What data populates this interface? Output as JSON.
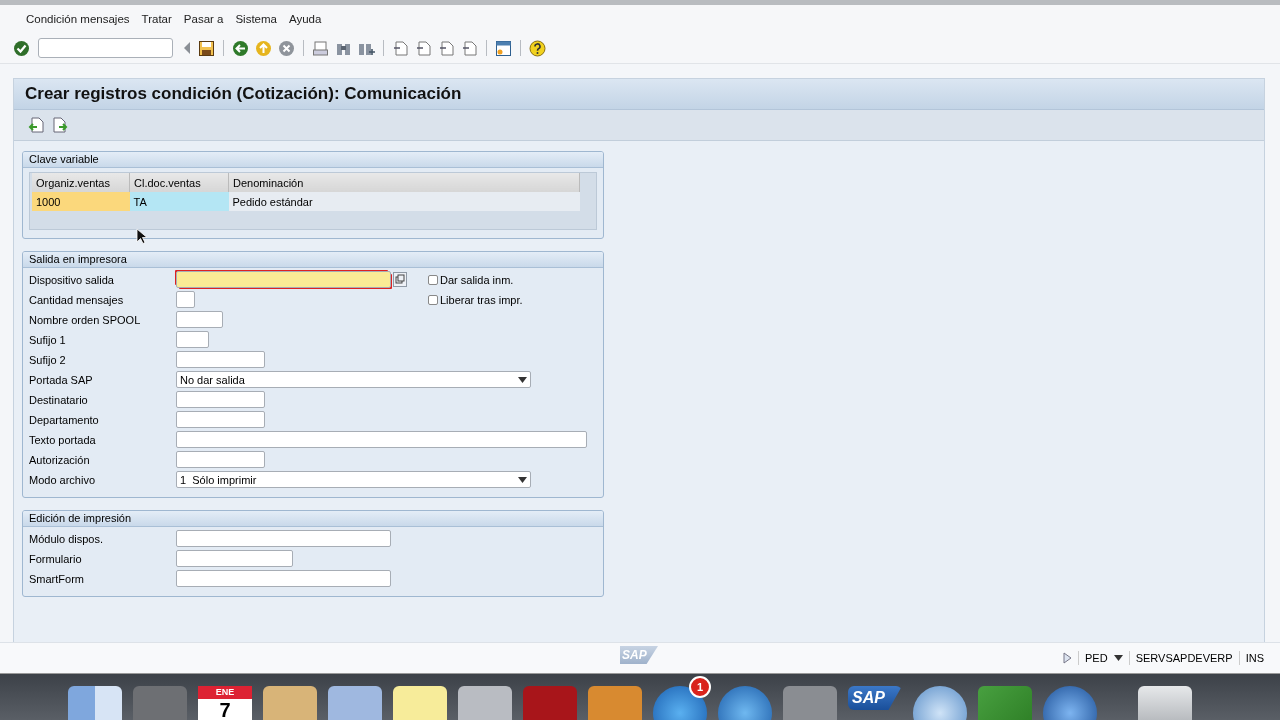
{
  "menu": [
    "Condición mensajes",
    "Tratar",
    "Pasar a",
    "Sistema",
    "Ayuda"
  ],
  "title": "Crear registros condición (Cotización): Comunicación",
  "clave_variable": {
    "title": "Clave variable",
    "columns": [
      {
        "label": "Organiz.ventas",
        "color": "#fbd87c"
      },
      {
        "label": "Cl.doc.ventas",
        "color": "#b4e6f4"
      },
      {
        "label": "Denominación"
      }
    ],
    "rows": [
      [
        "1000",
        "TA",
        "Pedido estándar"
      ]
    ]
  },
  "salida": {
    "title": "Salida en impresora",
    "fields": [
      {
        "label": "Dispositivo salida",
        "kind": "input",
        "required": true,
        "focused": true,
        "value_help": true
      },
      {
        "label": "Cantidad mensajes",
        "kind": "input",
        "required": false,
        "focused": false,
        "value_help": false
      },
      {
        "label": "Nombre orden SPOOL",
        "kind": "input",
        "required": false,
        "focused": false,
        "value_help": false
      },
      {
        "label": "Sufijo 1",
        "kind": "input",
        "required": false,
        "focused": false,
        "value_help": false
      },
      {
        "label": "Sufijo 2",
        "kind": "input",
        "required": false,
        "focused": false,
        "value_help": false
      },
      {
        "label": "Portada SAP",
        "kind": "select",
        "value": "No dar salida",
        "required": false,
        "focused": false,
        "value_help": false
      },
      {
        "label": "Destinatario",
        "kind": "input",
        "required": false,
        "focused": false,
        "value_help": false
      },
      {
        "label": "Departamento",
        "kind": "input",
        "required": false,
        "focused": false,
        "value_help": false
      },
      {
        "label": "Texto portada",
        "kind": "input",
        "required": false,
        "focused": false,
        "value_help": false
      },
      {
        "label": "Autorización",
        "kind": "input",
        "required": false,
        "focused": false,
        "value_help": false
      },
      {
        "label": "Modo archivo",
        "kind": "select",
        "value": "1  Sólo imprimir",
        "required": false,
        "focused": false,
        "value_help": false
      }
    ],
    "checkboxes": [
      {
        "label": "Dar salida inm.",
        "checked": false
      },
      {
        "label": "Liberar tras impr.",
        "checked": false
      }
    ]
  },
  "edicion": {
    "title": "Edición de impresión",
    "fields": [
      {
        "label": "Módulo dispos.",
        "kind": "input",
        "required": false,
        "focused": false,
        "value_help": false
      },
      {
        "label": "Formulario",
        "kind": "input",
        "required": false,
        "focused": false,
        "value_help": false
      },
      {
        "label": "SmartForm",
        "kind": "input",
        "required": false,
        "focused": false,
        "value_help": false
      }
    ]
  },
  "status_bar": {
    "logo": "SAP",
    "system": "PED",
    "server": "SERVSAPDEVERP",
    "mode": "INS"
  },
  "dock": {
    "calendar_month": "ENE",
    "calendar_day": "7",
    "app_store_badge": "1",
    "sap_logo": "SAP"
  }
}
